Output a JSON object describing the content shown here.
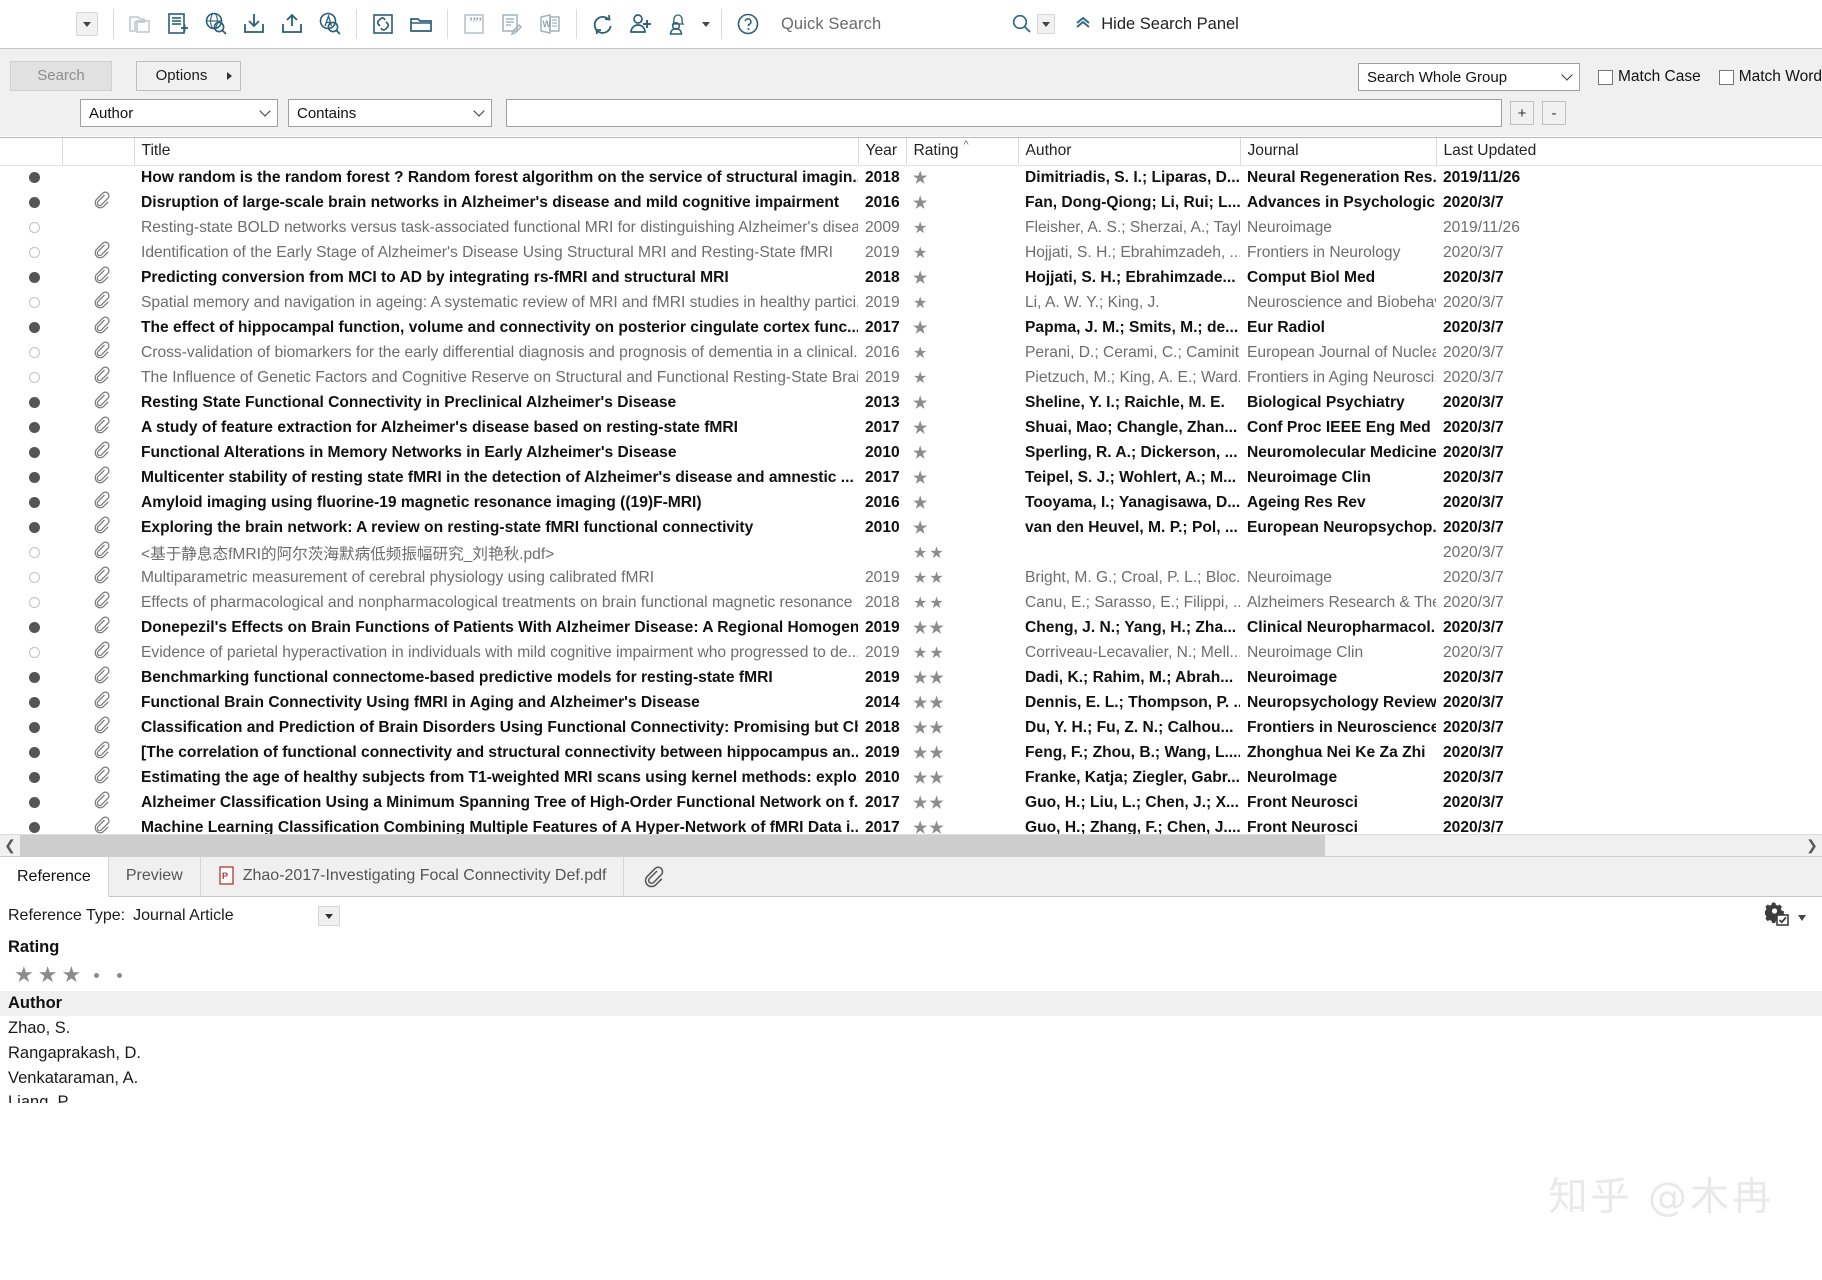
{
  "toolbar": {
    "dropdown_caret": "caret-down",
    "buttons": [
      {
        "name": "copy-to-local-library-icon",
        "disabled": true
      },
      {
        "name": "new-reference-icon",
        "disabled": false
      },
      {
        "name": "online-search-icon",
        "disabled": false
      },
      {
        "name": "import-icon",
        "disabled": false
      },
      {
        "name": "export-icon",
        "disabled": false
      },
      {
        "name": "find-full-text-pdf-icon",
        "disabled": false
      },
      {
        "name": "link-icon",
        "disabled": false
      },
      {
        "name": "open-file-icon",
        "disabled": false
      },
      {
        "name": "insert-citation-icon",
        "disabled": false
      },
      {
        "name": "format-bibliography-icon",
        "disabled": false
      },
      {
        "name": "word-export-icon",
        "disabled": false
      },
      {
        "name": "sync-icon",
        "disabled": false
      },
      {
        "name": "share-library-icon",
        "disabled": false
      },
      {
        "name": "notification-bell-icon",
        "disabled": false
      },
      {
        "name": "help-icon",
        "disabled": false
      }
    ],
    "quick_search_placeholder": "Quick Search",
    "hide_search_panel_label": "Hide Search Panel"
  },
  "search_panel": {
    "search_button": "Search",
    "options_button": "Options",
    "scope_value": "Search Whole Group",
    "match_case_label": "Match Case",
    "match_word_label": "Match Word",
    "field_value": "Author",
    "operator_value": "Contains",
    "term_value": "",
    "term_placeholder": "",
    "add_row_label": "+",
    "remove_row_label": "-"
  },
  "table": {
    "columns": [
      "",
      "",
      "Title",
      "Year",
      "Rating",
      "Author",
      "Journal",
      "Last Updated"
    ],
    "sort_column": "Rating",
    "sort_indicator": "^",
    "rows": [
      {
        "read": false,
        "clip": false,
        "title": "How random is the random forest ? Random forest algorithm on the service of structural imagin...",
        "year": "2018",
        "rating": 1,
        "author": "Dimitriadis, S. I.; Liparas, D....",
        "journal": "Neural Regeneration Res...",
        "updated": "2019/11/26"
      },
      {
        "read": false,
        "clip": true,
        "title": "Disruption of large-scale brain networks in Alzheimer's disease and mild cognitive impairment",
        "year": "2016",
        "rating": 1,
        "author": "Fan, Dong-Qiong; Li, Rui; L...",
        "journal": "Advances in Psychologic...",
        "updated": "2020/3/7"
      },
      {
        "read": true,
        "clip": false,
        "title": "Resting-state BOLD networks versus task-associated functional MRI for distinguishing Alzheimer's disea...",
        "year": "2009",
        "rating": 1,
        "author": "Fleisher, A. S.; Sherzai, A.; Tayl...",
        "journal": "Neuroimage",
        "updated": "2019/11/26"
      },
      {
        "read": true,
        "clip": true,
        "title": "Identification of the Early Stage of Alzheimer's Disease Using Structural MRI and Resting-State fMRI",
        "year": "2019",
        "rating": 1,
        "author": "Hojjati, S. H.; Ebrahimzadeh, ...",
        "journal": "Frontiers in Neurology",
        "updated": "2020/3/7"
      },
      {
        "read": false,
        "clip": true,
        "title": "Predicting conversion from MCI to AD by integrating rs-fMRI and structural MRI",
        "year": "2018",
        "rating": 1,
        "author": "Hojjati, S. H.; Ebrahimzade...",
        "journal": "Comput Biol Med",
        "updated": "2020/3/7"
      },
      {
        "read": true,
        "clip": true,
        "title": "Spatial memory and navigation in ageing: A systematic review of MRI and fMRI studies in healthy partici...",
        "year": "2019",
        "rating": 1,
        "author": "Li, A. W. Y.; King, J.",
        "journal": "Neuroscience and Biobehav...",
        "updated": "2020/3/7"
      },
      {
        "read": false,
        "clip": true,
        "title": "The effect of hippocampal function, volume and connectivity on posterior cingulate cortex func...",
        "year": "2017",
        "rating": 1,
        "author": "Papma, J. M.; Smits, M.; de...",
        "journal": "Eur Radiol",
        "updated": "2020/3/7"
      },
      {
        "read": true,
        "clip": true,
        "title": "Cross-validation of biomarkers for the early differential diagnosis and prognosis of dementia in a clinical...",
        "year": "2016",
        "rating": 1,
        "author": "Perani, D.; Cerami, C.; Caminit...",
        "journal": "European Journal of Nuclea...",
        "updated": "2020/3/7"
      },
      {
        "read": true,
        "clip": true,
        "title": "The Influence of Genetic Factors and Cognitive Reserve on Structural and Functional Resting-State Brain ...",
        "year": "2019",
        "rating": 1,
        "author": "Pietzuch, M.; King, A. E.; Ward...",
        "journal": "Frontiers in Aging Neurosci...",
        "updated": "2020/3/7"
      },
      {
        "read": false,
        "clip": true,
        "title": "Resting State Functional Connectivity in Preclinical Alzheimer's Disease",
        "year": "2013",
        "rating": 1,
        "author": "Sheline, Y. I.; Raichle, M. E.",
        "journal": "Biological Psychiatry",
        "updated": "2020/3/7"
      },
      {
        "read": false,
        "clip": true,
        "title": "A study of feature extraction for Alzheimer's disease based on resting-state fMRI",
        "year": "2017",
        "rating": 1,
        "author": "Shuai, Mao; Changle, Zhan...",
        "journal": "Conf Proc IEEE Eng Med ...",
        "updated": "2020/3/7"
      },
      {
        "read": false,
        "clip": true,
        "title": "Functional Alterations in Memory Networks in Early Alzheimer's Disease",
        "year": "2010",
        "rating": 1,
        "author": "Sperling, R. A.; Dickerson, ...",
        "journal": "Neuromolecular Medicine",
        "updated": "2020/3/7"
      },
      {
        "read": false,
        "clip": true,
        "title": "Multicenter stability of resting state fMRI in the detection of Alzheimer's disease and amnestic ...",
        "year": "2017",
        "rating": 1,
        "author": "Teipel, S. J.; Wohlert, A.; M...",
        "journal": "Neuroimage Clin",
        "updated": "2020/3/7"
      },
      {
        "read": false,
        "clip": true,
        "title": "Amyloid imaging using fluorine-19 magnetic resonance imaging ((19)F-MRI)",
        "year": "2016",
        "rating": 1,
        "author": "Tooyama, I.; Yanagisawa, D...",
        "journal": "Ageing Res Rev",
        "updated": "2020/3/7"
      },
      {
        "read": false,
        "clip": true,
        "title": "Exploring the brain network: A review on resting-state fMRI functional connectivity",
        "year": "2010",
        "rating": 1,
        "author": "van den Heuvel, M. P.; Pol, ...",
        "journal": "European Neuropsychop...",
        "updated": "2020/3/7"
      },
      {
        "read": true,
        "clip": true,
        "title": "<基于静息态fMRI的阿尔茨海默病低频振幅研究_刘艳秋.pdf>",
        "year": "",
        "rating": 2,
        "author": "",
        "journal": "",
        "updated": "2020/3/7"
      },
      {
        "read": true,
        "clip": true,
        "title": "Multiparametric measurement of cerebral physiology using calibrated fMRI",
        "year": "2019",
        "rating": 2,
        "author": "Bright, M. G.; Croal, P. L.; Bloc...",
        "journal": "Neuroimage",
        "updated": "2020/3/7"
      },
      {
        "read": true,
        "clip": true,
        "title": "Effects of pharmacological and nonpharmacological treatments on brain functional magnetic resonance ...",
        "year": "2018",
        "rating": 2,
        "author": "Canu, E.; Sarasso, E.; Filippi, ...",
        "journal": "Alzheimers Research & Ther...",
        "updated": "2020/3/7"
      },
      {
        "read": false,
        "clip": true,
        "title": "Donepezil's Effects on Brain Functions of Patients With Alzheimer Disease: A Regional Homogen...",
        "year": "2019",
        "rating": 2,
        "author": "Cheng, J. N.; Yang, H.; Zha...",
        "journal": "Clinical Neuropharmacol...",
        "updated": "2020/3/7"
      },
      {
        "read": true,
        "clip": true,
        "title": "Evidence of parietal hyperactivation in individuals with mild cognitive impairment who progressed to de...",
        "year": "2019",
        "rating": 2,
        "author": "Corriveau-Lecavalier, N.; Mell...",
        "journal": "Neuroimage Clin",
        "updated": "2020/3/7"
      },
      {
        "read": false,
        "clip": true,
        "title": "Benchmarking functional connectome-based predictive models for resting-state fMRI",
        "year": "2019",
        "rating": 2,
        "author": "Dadi, K.; Rahim, M.; Abrah...",
        "journal": "Neuroimage",
        "updated": "2020/3/7"
      },
      {
        "read": false,
        "clip": true,
        "title": "Functional Brain Connectivity Using fMRI in Aging and Alzheimer's Disease",
        "year": "2014",
        "rating": 2,
        "author": "Dennis, E. L.; Thompson, P. ...",
        "journal": "Neuropsychology Review",
        "updated": "2020/3/7"
      },
      {
        "read": false,
        "clip": true,
        "title": "Classification and Prediction of Brain Disorders Using Functional Connectivity: Promising but Ch...",
        "year": "2018",
        "rating": 2,
        "author": "Du, Y. H.; Fu, Z. N.; Calhou...",
        "journal": "Frontiers in Neuroscience",
        "updated": "2020/3/7"
      },
      {
        "read": false,
        "clip": true,
        "title": "[The correlation of functional connectivity and structural connectivity between hippocampus an...",
        "year": "2019",
        "rating": 2,
        "author": "Feng, F.; Zhou, B.; Wang, L....",
        "journal": "Zhonghua Nei Ke Za Zhi",
        "updated": "2020/3/7"
      },
      {
        "read": false,
        "clip": true,
        "title": "Estimating the age of healthy subjects from T1-weighted MRI scans using kernel methods: explo...",
        "year": "2010",
        "rating": 2,
        "author": "Franke, Katja; Ziegler, Gabr...",
        "journal": "NeuroImage",
        "updated": "2020/3/7"
      },
      {
        "read": false,
        "clip": true,
        "title": "Alzheimer Classification Using a Minimum Spanning Tree of High-Order Functional Network on f...",
        "year": "2017",
        "rating": 2,
        "author": "Guo, H.; Liu, L.; Chen, J.; X...",
        "journal": "Front Neurosci",
        "updated": "2020/3/7"
      },
      {
        "read": false,
        "clip": true,
        "title": "Machine Learning Classification Combining Multiple Features of A Hyper-Network of fMRI Data i...",
        "year": "2017",
        "rating": 2,
        "author": "Guo, H.; Zhang, F.; Chen, J....",
        "journal": "Front Neurosci",
        "updated": "2020/3/7"
      }
    ]
  },
  "bottom_panel": {
    "tabs": [
      {
        "label": "Reference",
        "active": true,
        "icon": ""
      },
      {
        "label": "Preview",
        "active": false,
        "icon": ""
      },
      {
        "label": "Zhao-2017-Investigating Focal Connectivity Def.pdf",
        "active": false,
        "icon": "pdf-icon"
      }
    ],
    "attachment_icon": "paperclip-icon",
    "reference_type_label": "Reference Type:",
    "reference_type_value": "Journal Article",
    "settings_icon": "gear-icon",
    "fields": [
      {
        "name": "Rating",
        "shaded": false
      },
      {
        "name": "Author",
        "shaded": true
      }
    ],
    "rating_stars_filled": 3,
    "rating_dots": 2,
    "authors": [
      "Zhao, S.",
      "Rangaprakash, D.",
      "Venkataraman, A.",
      "Liang, P."
    ]
  },
  "watermark": "知乎 @木冉",
  "colors": {
    "icon_teal": "#2b5f77",
    "icon_disabled": "#b9c7cf",
    "panel_bg": "#f0f0f0",
    "scroll_thumb": "#cdcdcd",
    "star_gray": "#8c8c8c",
    "dot_filled": "#555555"
  }
}
